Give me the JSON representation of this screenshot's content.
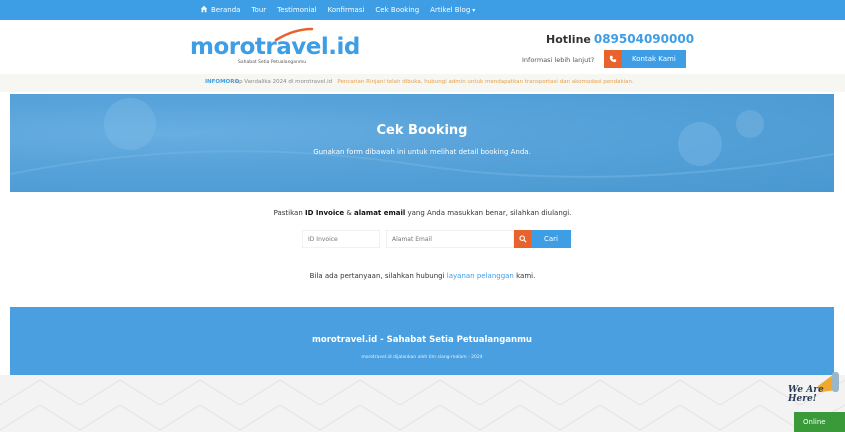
{
  "nav": {
    "items": [
      "Beranda",
      "Tour",
      "Testimonial",
      "Konfirmasi",
      "Cek Booking",
      "Artikel Blog"
    ],
    "icons": {
      "home": "home-icon",
      "dropdown": "chevron-down-icon"
    }
  },
  "header": {
    "logo": {
      "moro": "moro",
      "travel": "travel",
      "tld": ".id",
      "tagline": "Sahabat Setia Petualanganmu"
    },
    "hotline_label": "Hotline",
    "hotline_number": "089504090000",
    "info_text": "Informasi lebih lanjut?",
    "contact_button": "Kontak Kami",
    "contact_icon": "phone-icon"
  },
  "infobar": {
    "label": "INFOMORO",
    "ticker_text": "Lp Vandalika 2024 di morotravel.id",
    "ticker_highlight": "Pencarian Rinjani telah dibuka, hubungi admin untuk mendapatkan transportasi dan akomodasi pendakian."
  },
  "hero": {
    "title": "Cek Booking",
    "subtitle": "Gunakan form dibawah ini untuk melihat detail booking Anda."
  },
  "main": {
    "instruction_pre": "Pastikan ",
    "instruction_b1": "ID Invoice",
    "instruction_mid": " & ",
    "instruction_b2": "alamat email",
    "instruction_post": " yang Anda masukkan benar, silahkan diulangi.",
    "invoice_placeholder": "ID Invoice",
    "email_placeholder": "Alamat Email",
    "search_button": "Cari",
    "search_icon": "search-icon",
    "help_pre": "Bila ada pertanyaan, silahkan hubungi ",
    "help_link": "layanan pelanggan",
    "help_post": " kami."
  },
  "footer": {
    "title": "morotravel.id - Sahabat Setia Petualanganmu",
    "subtitle": "morotravel.id dijalankan oleh tim siang-malam - 2024"
  },
  "widget": {
    "line1": "We Are",
    "line2": "Here!",
    "online": "Online"
  },
  "colors": {
    "brand": "#3d9ee6",
    "accent": "#e8622c",
    "online": "#3a9a3a"
  }
}
